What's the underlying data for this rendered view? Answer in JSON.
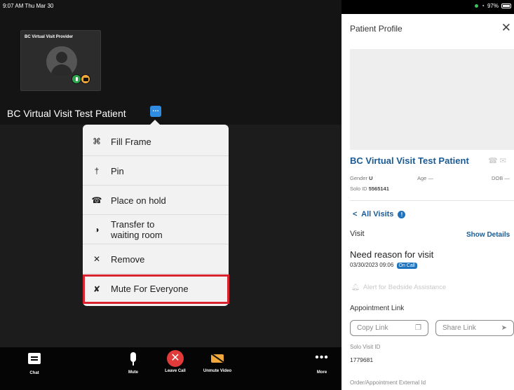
{
  "status_bar": {
    "time": "9:07 AM  Thu Mar 30",
    "battery": "97%"
  },
  "self_tile": {
    "name": "BC Virtual Visit Provider"
  },
  "call": {
    "patient_name": "BC Virtual Visit Test Patient",
    "more_chip": "…"
  },
  "menu": {
    "items": [
      {
        "icon": "fill-frame-icon",
        "glyph": "⌘",
        "label": "Fill Frame"
      },
      {
        "icon": "pin-icon",
        "glyph": "†",
        "label": "Pin"
      },
      {
        "icon": "hold-icon",
        "glyph": "☎",
        "label": "Place on hold"
      },
      {
        "icon": "waiting-room-icon",
        "glyph": "◑",
        "label": "Transfer to waiting room"
      },
      {
        "icon": "remove-icon",
        "glyph": "✕",
        "label": "Remove"
      },
      {
        "icon": "mute-all-icon",
        "glyph": "✘",
        "label": "Mute For Everyone"
      }
    ]
  },
  "controls": {
    "chat": "Chat",
    "mute": "Mute",
    "leave": "Leave Call",
    "unmute_video": "Unmute Video",
    "more": "More",
    "leave_glyph": "✕",
    "more_glyph": "•••"
  },
  "profile": {
    "title": "Patient Profile",
    "close": "✕",
    "name": "BC Virtual Visit Test Patient",
    "gender_label": "Gender",
    "gender": "U",
    "age_label": "Age",
    "age": "—",
    "dob_label": "DOB",
    "dob": "—",
    "solo_label": "Solo ID",
    "solo_id": "5565141",
    "all_visits": "All Visits",
    "all_visits_back": "<",
    "visit_label": "Visit",
    "show_details": "Show Details",
    "reason": "Need reason for visit",
    "date": "03/30/2023 09:06",
    "on_call": "On Call",
    "alert": "Alert for Bedside Assistance",
    "appointment_link": "Appointment Link",
    "copy_link": "Copy Link",
    "share_link": "Share Link",
    "solo_visit_label": "Solo Visit ID",
    "solo_visit_id": "1779681",
    "external_id_label": "Order/Appointment External Id"
  },
  "colors": {
    "accent": "#1c5a93",
    "highlight": "#d9232e",
    "leave": "#e03a3a",
    "video_off": "#f2a93b"
  }
}
